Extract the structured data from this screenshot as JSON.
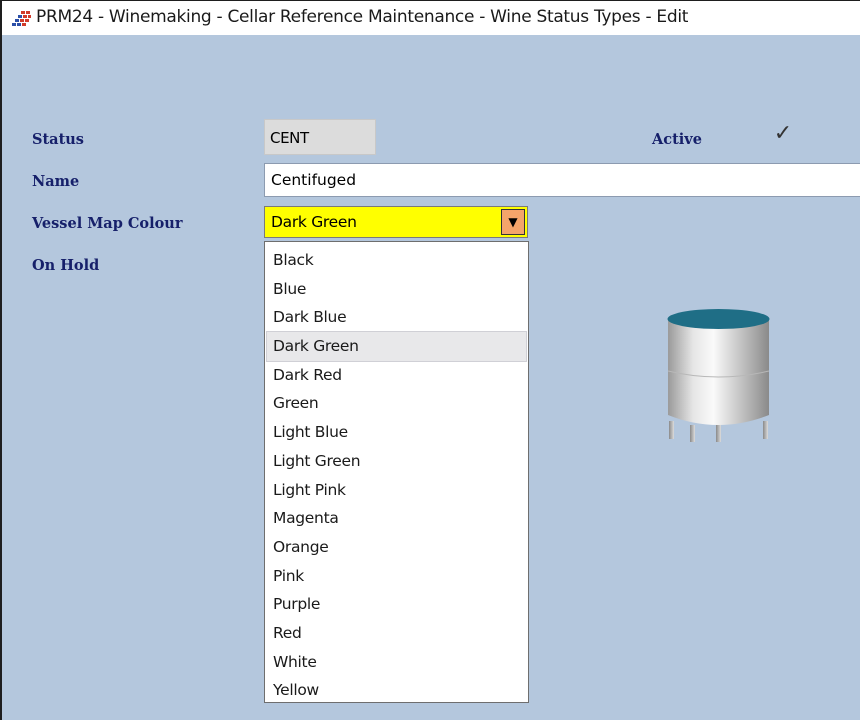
{
  "window": {
    "title": "PRM24 - Winemaking - Cellar Reference Maintenance - Wine Status Types - Edit"
  },
  "form": {
    "status_label": "Status",
    "status_value": "CENT",
    "active_label": "Active",
    "active_checked": true,
    "name_label": "Name",
    "name_value": "Centifuged",
    "vessel_map_colour_label": "Vessel Map Colour",
    "vessel_map_colour_value": "Dark Green",
    "on_hold_label": "On Hold"
  },
  "dropdown": {
    "highlighted": "Dark Green",
    "options": [
      "Black",
      "Blue",
      "Dark Blue",
      "Dark Green",
      "Dark Red",
      "Green",
      "Light Blue",
      "Light Green",
      "Light Pink",
      "Magenta",
      "Orange",
      "Pink",
      "Purple",
      "Red",
      "White",
      "Yellow"
    ]
  },
  "colors": {
    "form_background": "#b4c7dd",
    "label_text": "#16206a",
    "combo_highlight": "#ffff00",
    "combo_button": "#f4a46a",
    "vessel_top": "#1f6e86"
  },
  "icons": {
    "app": "app-logo-icon",
    "checkbox": "checkmark-icon",
    "combo": "dropdown-arrow-icon",
    "vessel": "tank-vessel-icon"
  }
}
